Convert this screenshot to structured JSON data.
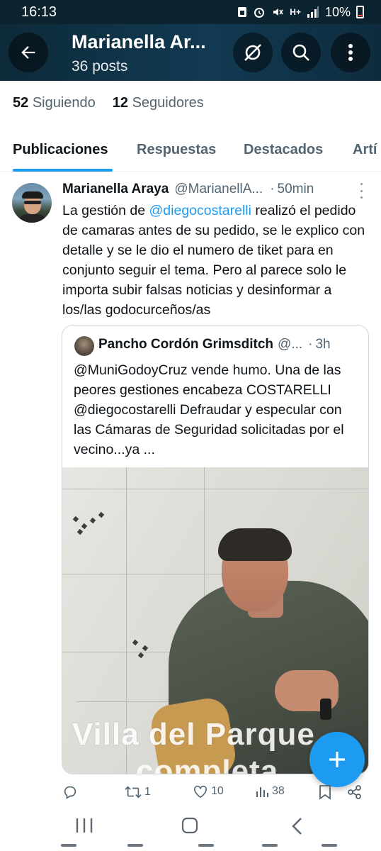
{
  "status_bar": {
    "time": "16:13",
    "network": "H+",
    "battery": "10%"
  },
  "header": {
    "title": "Marianella Ar...",
    "subtitle": "36 posts"
  },
  "profile_stats": {
    "following_count": "52",
    "following_label": "Siguiendo",
    "followers_count": "12",
    "followers_label": "Seguidores"
  },
  "tabs": [
    {
      "label": "Publicaciones",
      "active": true
    },
    {
      "label": "Respuestas"
    },
    {
      "label": "Destacados"
    },
    {
      "label": "Artí"
    }
  ],
  "tweet": {
    "author_name": "Marianella Araya",
    "author_handle": "@MarianellA...",
    "separator": "·",
    "time": "50min",
    "text_before": "La gestión de ",
    "mention": "@diegocostarelli",
    "text_after": " realizó el pedido de camaras antes de su pedido, se le explico con detalle y se le dio el numero de tiket para en conjunto seguir el tema. Pero al parece solo le importa subir falsas noticias y desinformar a los/las godocurceños/as"
  },
  "quote": {
    "author_name": "Pancho Cordón Grimsditch",
    "author_handle": "@...",
    "separator": "·",
    "time": "3h",
    "text": "@MuniGodoyCruz vende humo. Una de las peores gestiones encabeza COSTARELLI @diegocostarelli Defraudar y especular con las Cámaras de Seguridad solicitadas por el vecino...ya ...",
    "media_caption_line1": "Villa del Parque",
    "media_caption_line2": "completa"
  },
  "actions": {
    "reply_count": "",
    "retweet_count": "1",
    "like_count": "10",
    "views_count": "38"
  },
  "colors": {
    "accent": "#1d9bf0",
    "header_bg": "#0d2a3a",
    "text_secondary": "#536471"
  }
}
